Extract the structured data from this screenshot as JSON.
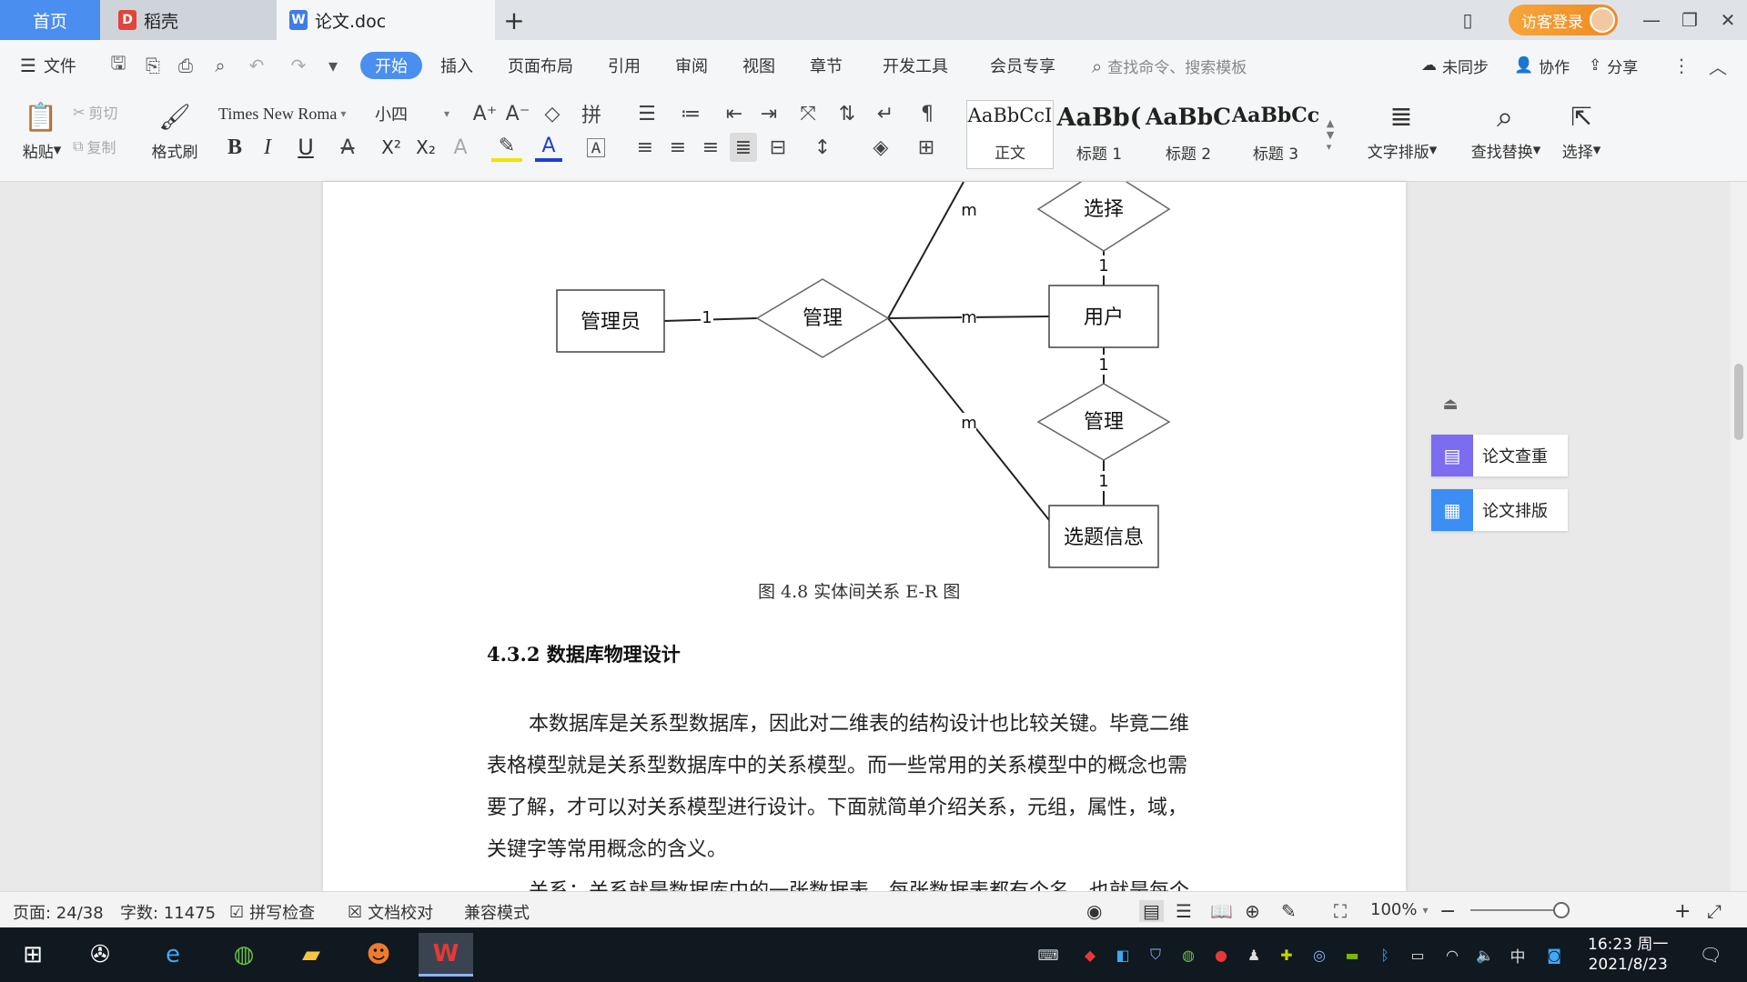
{
  "tabs": {
    "home": "首页",
    "daoke": "稻壳",
    "doc": "论文.doc"
  },
  "login_label": "访客登录",
  "menu": {
    "file": "文件",
    "start": "开始",
    "insert": "插入",
    "layout": "页面布局",
    "reference": "引用",
    "review": "审阅",
    "view": "视图",
    "chapter": "章节",
    "devtools": "开发工具",
    "member": "会员专享",
    "search": "查找命令、搜索模板",
    "unsync": "未同步",
    "collab": "协作",
    "share": "分享"
  },
  "ribbon": {
    "paste": "粘贴",
    "cut": "剪切",
    "copy": "复制",
    "format_painter": "格式刷",
    "font_name": "Times New Roma",
    "font_size": "小四",
    "bold": "B",
    "italic": "I",
    "underline": "U",
    "superscript": "X²",
    "subscript": "X₂",
    "styles": [
      {
        "sample": "AaBbCcI",
        "name": "正文"
      },
      {
        "sample": "AaBb(",
        "name": "标题 1"
      },
      {
        "sample": "AaBbC",
        "name": "标题 2"
      },
      {
        "sample": "AaBbCcl",
        "name": "标题 3"
      }
    ],
    "text_layout": "文字排版",
    "find_replace": "查找替换",
    "select": "选择"
  },
  "er_diagram": {
    "entities": {
      "admin": "管理员",
      "user": "用户",
      "topic": "选题信息"
    },
    "relations": {
      "manage_main": "管理",
      "select": "选择",
      "manage_right": "管理"
    },
    "cardinalities": {
      "admin_manage": "1",
      "manage_user": "m",
      "manage_top": "m",
      "manage_topic": "m",
      "select_user": "1",
      "user_manage": "1",
      "manage_topic_right": "1"
    }
  },
  "document": {
    "figure_caption": "图 4.8  实体间关系 E-R 图",
    "section_heading": "4.3.2  数据库物理设计",
    "paragraph_lines": [
      "本数据库是关系型数据库，因此对二维表的结构设计也比较关键。毕竟二维",
      "表格模型就是关系型数据库中的关系模型。而一些常用的关系模型中的概念也需",
      "要了解，才可以对关系模型进行设计。下面就简单介绍关系，元组，属性，域，",
      "关键字等常用概念的含义。",
      "关系：关系就是数据库中的一张数据表，每张数据表都有个名，也就是每个"
    ]
  },
  "side_panel": {
    "check": "论文查重",
    "format": "论文排版"
  },
  "status": {
    "page": "页面: 24/38",
    "words": "字数: 11475",
    "spell": "拼写检查",
    "proof": "文档校对",
    "compat": "兼容模式",
    "zoom": "100%"
  },
  "clock": {
    "time": "16:23 周一",
    "date": "2021/8/23"
  },
  "tray_lang": "中",
  "colors": {
    "accent": "#4a8ef0",
    "login": "#f08a1f",
    "side_check": "#7b6cf0",
    "side_format": "#3d8ef2"
  }
}
